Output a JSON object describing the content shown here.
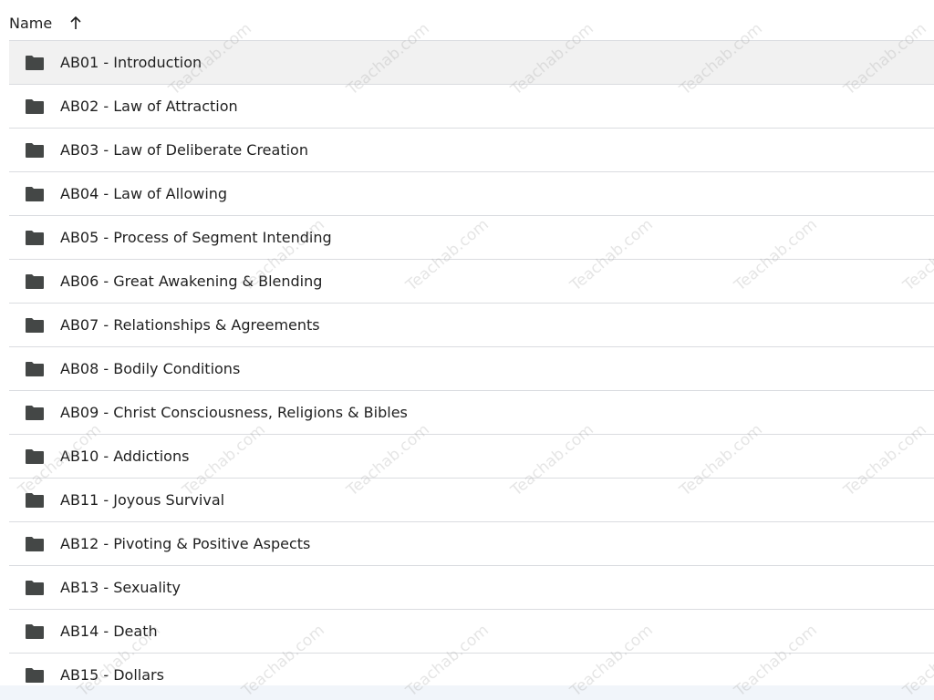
{
  "header": {
    "name_label": "Name",
    "sort_icon": "arrow-up-icon"
  },
  "folder_icon": "folder-icon",
  "items": [
    {
      "label": "AB01 - Introduction",
      "selected": true
    },
    {
      "label": "AB02 - Law of Attraction",
      "selected": false
    },
    {
      "label": "AB03 - Law of Deliberate Creation",
      "selected": false
    },
    {
      "label": "AB04 - Law of Allowing",
      "selected": false
    },
    {
      "label": "AB05 - Process of Segment Intending",
      "selected": false
    },
    {
      "label": "AB06 - Great Awakening & Blending",
      "selected": false
    },
    {
      "label": "AB07 - Relationships & Agreements",
      "selected": false
    },
    {
      "label": "AB08 - Bodily Conditions",
      "selected": false
    },
    {
      "label": "AB09 - Christ Consciousness, Religions & Bibles",
      "selected": false
    },
    {
      "label": "AB10 - Addictions",
      "selected": false
    },
    {
      "label": "AB11 - Joyous Survival",
      "selected": false
    },
    {
      "label": "AB12 - Pivoting & Positive Aspects",
      "selected": false
    },
    {
      "label": "AB13 - Sexuality",
      "selected": false
    },
    {
      "label": "AB14 - Death",
      "selected": false
    },
    {
      "label": "AB15 - Dollars",
      "selected": false
    }
  ],
  "watermark_text": "Teachab.com",
  "colors": {
    "divider": "#dadce0",
    "selected_row": "#f1f1f1",
    "text": "#1f1f1f",
    "icon": "#444746"
  }
}
